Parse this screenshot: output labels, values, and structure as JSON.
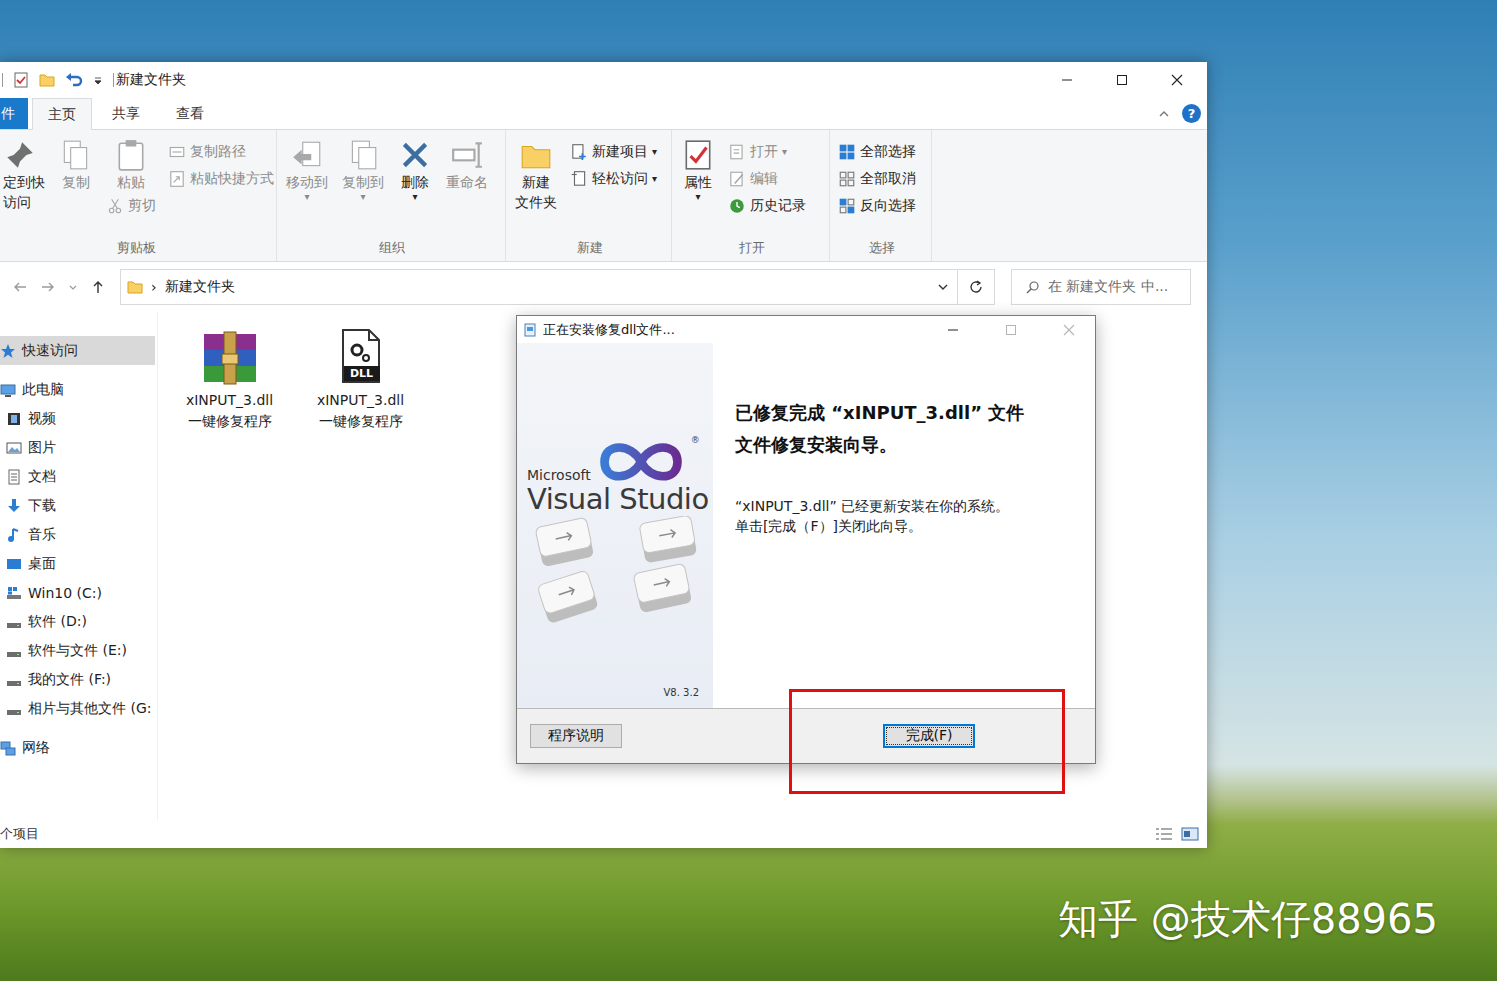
{
  "desktop": {
    "watermark": "知乎 @技术仔88965"
  },
  "explorer": {
    "title": "新建文件夹",
    "tabs": [
      {
        "label": "件",
        "kind": "file",
        "selected": false
      },
      {
        "label": "主页",
        "kind": "tab",
        "selected": true
      },
      {
        "label": "共享",
        "kind": "tab",
        "selected": false
      },
      {
        "label": "查看",
        "kind": "tab",
        "selected": false
      }
    ],
    "help": "?",
    "ribbon_groups": [
      {
        "label": "剪贴板",
        "columns": [
          [
            {
              "kind": "large",
              "lines": [
                "定到快",
                "访问"
              ],
              "disabled": false
            }
          ],
          [
            {
              "kind": "large",
              "lines": [
                "复制"
              ],
              "disabled": true
            }
          ],
          [
            {
              "kind": "large",
              "lines": [
                "粘贴"
              ],
              "disabled": true
            },
            {
              "kind": "small",
              "lines": [
                "剪切"
              ],
              "disabled": true
            }
          ],
          [
            {
              "kind": "small",
              "lines": [
                "复制路径"
              ],
              "disabled": true
            },
            {
              "kind": "small",
              "lines": [
                "粘贴快捷方式"
              ],
              "disabled": true
            }
          ]
        ]
      },
      {
        "label": "组织",
        "columns": [
          [
            {
              "kind": "large",
              "lines": [
                "移动到"
              ],
              "disabled": true,
              "arrow": "▾"
            }
          ],
          [
            {
              "kind": "large",
              "lines": [
                "复制到"
              ],
              "disabled": true,
              "arrow": "▾"
            }
          ],
          [
            {
              "kind": "large",
              "lines": [
                "删除"
              ],
              "disabled": false,
              "arrow": "▾"
            }
          ],
          [
            {
              "kind": "large",
              "lines": [
                "重命名"
              ],
              "disabled": true
            }
          ]
        ]
      },
      {
        "label": "新建",
        "columns": [
          [
            {
              "kind": "large",
              "lines": [
                "新建",
                "文件夹"
              ],
              "disabled": false
            }
          ],
          [
            {
              "kind": "small",
              "lines": [
                "新建项目"
              ],
              "disabled": false,
              "arrow": "▾"
            },
            {
              "kind": "small",
              "lines": [
                "轻松访问"
              ],
              "disabled": false,
              "arrow": "▾"
            }
          ]
        ]
      },
      {
        "label": "打开",
        "columns": [
          [
            {
              "kind": "large",
              "lines": [
                "属性"
              ],
              "disabled": false,
              "arrow": "▾"
            }
          ],
          [
            {
              "kind": "small",
              "lines": [
                "打开"
              ],
              "disabled": true,
              "arrow": "▾"
            },
            {
              "kind": "small",
              "lines": [
                "编辑"
              ],
              "disabled": true
            },
            {
              "kind": "small",
              "lines": [
                "历史记录"
              ],
              "disabled": false
            }
          ]
        ]
      },
      {
        "label": "选择",
        "columns": [
          [
            {
              "kind": "small",
              "lines": [
                "全部选择"
              ],
              "disabled": false
            },
            {
              "kind": "small",
              "lines": [
                "全部取消"
              ],
              "disabled": false
            },
            {
              "kind": "small",
              "lines": [
                "反向选择"
              ],
              "disabled": false
            }
          ]
        ]
      }
    ],
    "address": {
      "separator": "›",
      "path": "新建文件夹"
    },
    "search": {
      "placeholder": "在 新建文件夹 中..."
    },
    "nav_items": [
      {
        "label": "快速访问",
        "kind": "root",
        "selected": true
      },
      {
        "label": "此电脑",
        "kind": "root",
        "selected": false
      },
      {
        "label": "视频",
        "kind": "child",
        "selected": false
      },
      {
        "label": "图片",
        "kind": "child",
        "selected": false
      },
      {
        "label": "文档",
        "kind": "child",
        "selected": false
      },
      {
        "label": "下载",
        "kind": "child",
        "selected": false
      },
      {
        "label": "音乐",
        "kind": "child",
        "selected": false
      },
      {
        "label": "桌面",
        "kind": "child",
        "selected": false
      },
      {
        "label": "Win10 (C:)",
        "kind": "child",
        "selected": false
      },
      {
        "label": "软件 (D:)",
        "kind": "child",
        "selected": false
      },
      {
        "label": "软件与文件 (E:)",
        "kind": "child",
        "selected": false
      },
      {
        "label": "我的文件 (F:)",
        "kind": "child",
        "selected": false
      },
      {
        "label": "相片与其他文件 (G:",
        "kind": "child",
        "selected": false
      },
      {
        "label": "网络",
        "kind": "root",
        "selected": false
      }
    ],
    "files": [
      {
        "name": "xINPUT_3.dll",
        "subtitle": "一键修复程序",
        "kind": "archive"
      },
      {
        "name": "xINPUT_3.dll",
        "subtitle": "一键修复程序",
        "kind": "dll",
        "badge": "DLL"
      }
    ],
    "status_bar": {
      "count": "个项目"
    }
  },
  "dialog": {
    "title": "正在安装修复dll文件...",
    "title_buttons": [
      {
        "kind": "minimize",
        "disabled": false
      },
      {
        "kind": "maximize",
        "disabled": true
      },
      {
        "kind": "close",
        "disabled": true
      }
    ],
    "logo": {
      "brand": "Microsoft",
      "product": "Visual Studio",
      "mark": "®"
    },
    "version": "V8. 3.2",
    "heading": [
      "已修复完成 “xINPUT_3.dll” 文件",
      "文件修复安装向导。"
    ],
    "body": [
      "“xINPUT_3.dll” 已经更新安装在你的系统。",
      "单击[完成（F）]关闭此向导。"
    ],
    "buttons": [
      {
        "label": "程序说明",
        "focused": false
      },
      {
        "label": "完成(F)",
        "focused": true
      }
    ]
  }
}
